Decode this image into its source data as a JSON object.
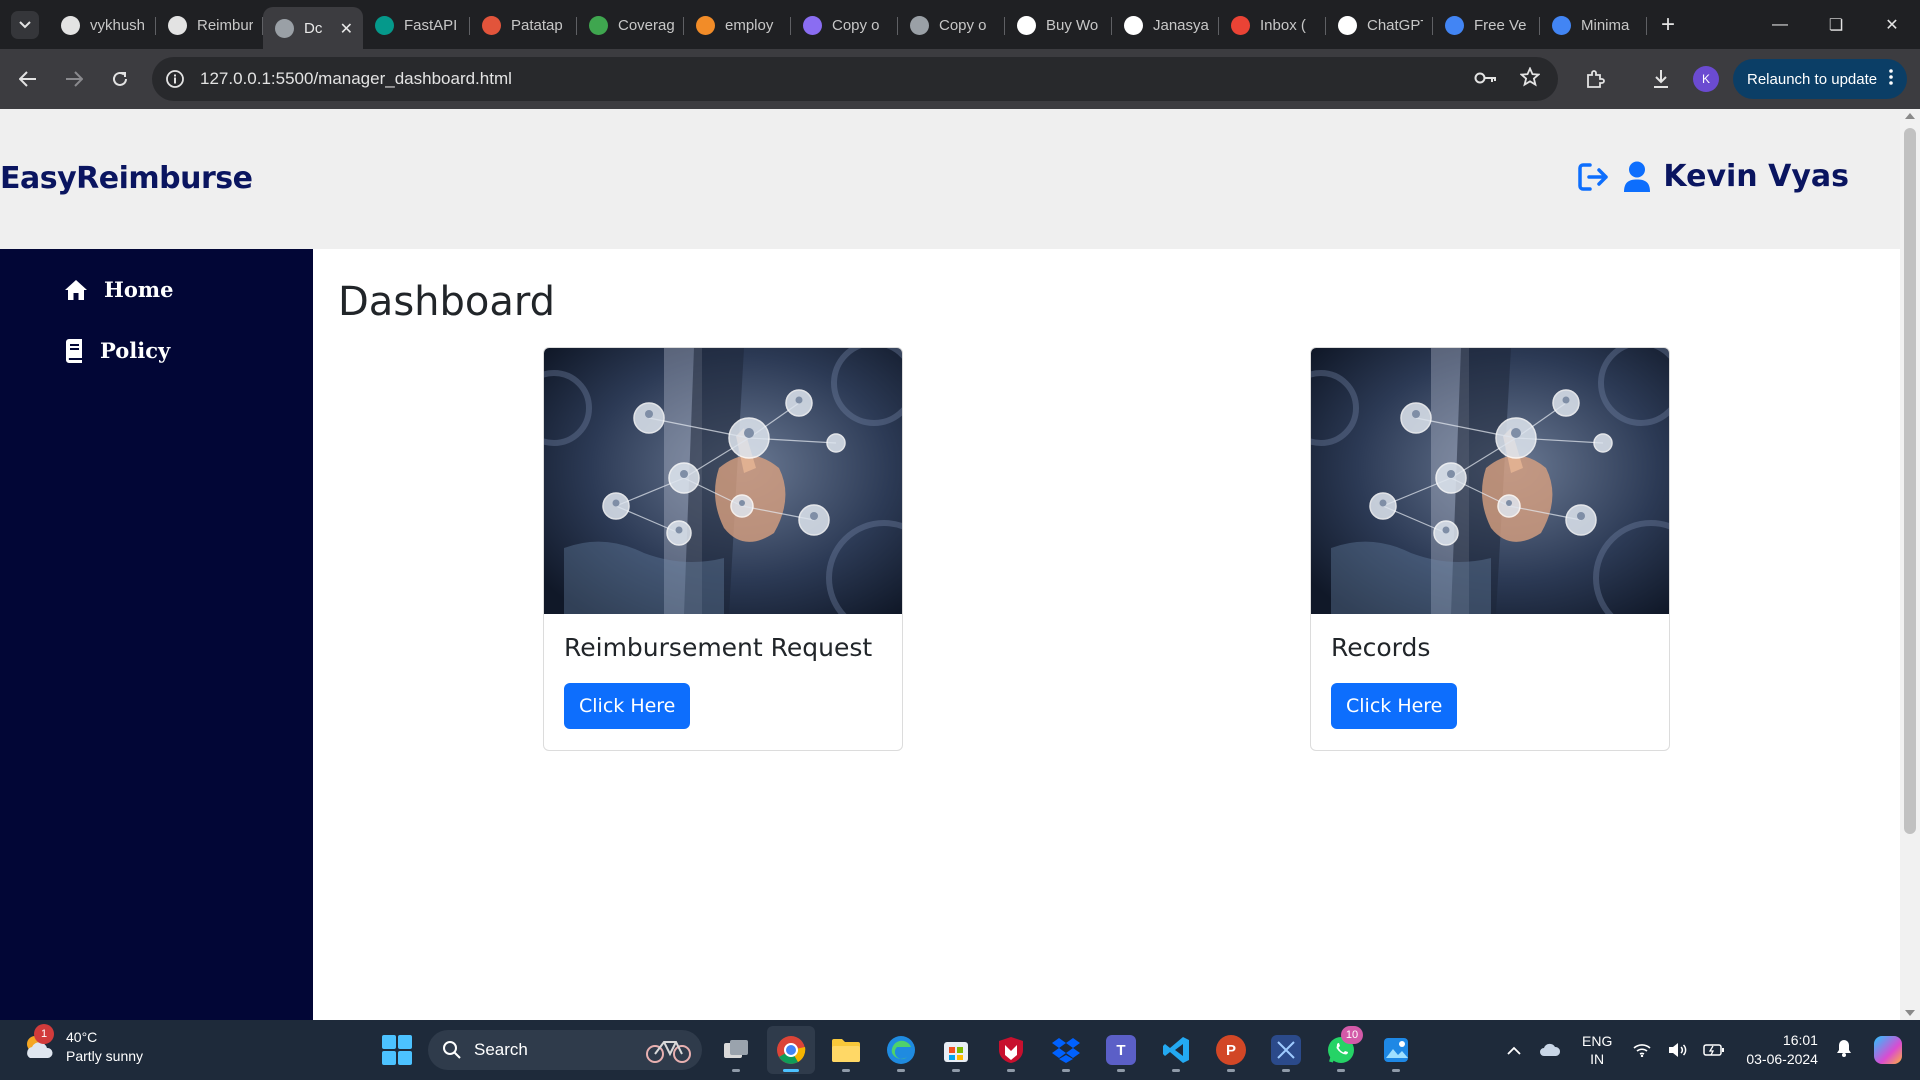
{
  "browser": {
    "tabs": [
      {
        "title": "vykhush",
        "color": "#e3e3e3",
        "icon": "github-icon"
      },
      {
        "title": "Reimburse",
        "color": "#e3e3e3",
        "icon": "github-icon"
      },
      {
        "title": "Dc",
        "color": "#9aa0a6",
        "icon": "globe-icon",
        "active": true
      },
      {
        "title": "FastAPI",
        "color": "#05998b",
        "icon": "fastapi-icon"
      },
      {
        "title": "Patatap",
        "color": "#e2543b",
        "icon": "patatap-icon"
      },
      {
        "title": "Coverage",
        "color": "#3fa64f",
        "icon": "coverage-icon"
      },
      {
        "title": "employ",
        "color": "#f28c28",
        "icon": "employ-icon"
      },
      {
        "title": "Copy o",
        "color": "#8a6df2",
        "icon": "copy-icon"
      },
      {
        "title": "Copy o",
        "color": "#9aa0a6",
        "icon": "globe-icon"
      },
      {
        "title": "Buy Wo",
        "color": "#ffffff",
        "icon": "amazon-icon"
      },
      {
        "title": "Janasya",
        "color": "#ffffff",
        "icon": "amazon-icon"
      },
      {
        "title": "Inbox (",
        "color": "#ea4335",
        "icon": "gmail-icon"
      },
      {
        "title": "ChatGPT",
        "color": "#ffffff",
        "icon": "chatgpt-icon"
      },
      {
        "title": "Free Ve",
        "color": "#4285f4",
        "icon": "forms-icon"
      },
      {
        "title": "Minima",
        "color": "#4285f4",
        "icon": "forms-icon"
      }
    ],
    "url": "127.0.0.1:5500/manager_dashboard.html",
    "profile_initial": "K",
    "relaunch_label": "Relaunch to update"
  },
  "app": {
    "brand": "EasyReimburse",
    "user_name": "Kevin Vyas",
    "brand_color": "#0a1560",
    "sidebar_color": "#020636"
  },
  "sidebar": {
    "items": [
      {
        "label": "Home",
        "icon": "home-icon"
      },
      {
        "label": "Policy",
        "icon": "policy-icon"
      }
    ]
  },
  "main": {
    "title": "Dashboard",
    "cards": [
      {
        "title": "Reimbursement Request",
        "button": "Click Here"
      },
      {
        "title": "Records",
        "button": "Click Here"
      }
    ],
    "button_color": "#0d6efd"
  },
  "taskbar": {
    "weather": {
      "temp": "40°C",
      "desc": "Partly sunny",
      "badge": "1"
    },
    "search_label": "Search",
    "whatsapp_badge": "10",
    "lang_line1": "ENG",
    "lang_line2": "IN",
    "time": "16:01",
    "date": "03-06-2024"
  }
}
